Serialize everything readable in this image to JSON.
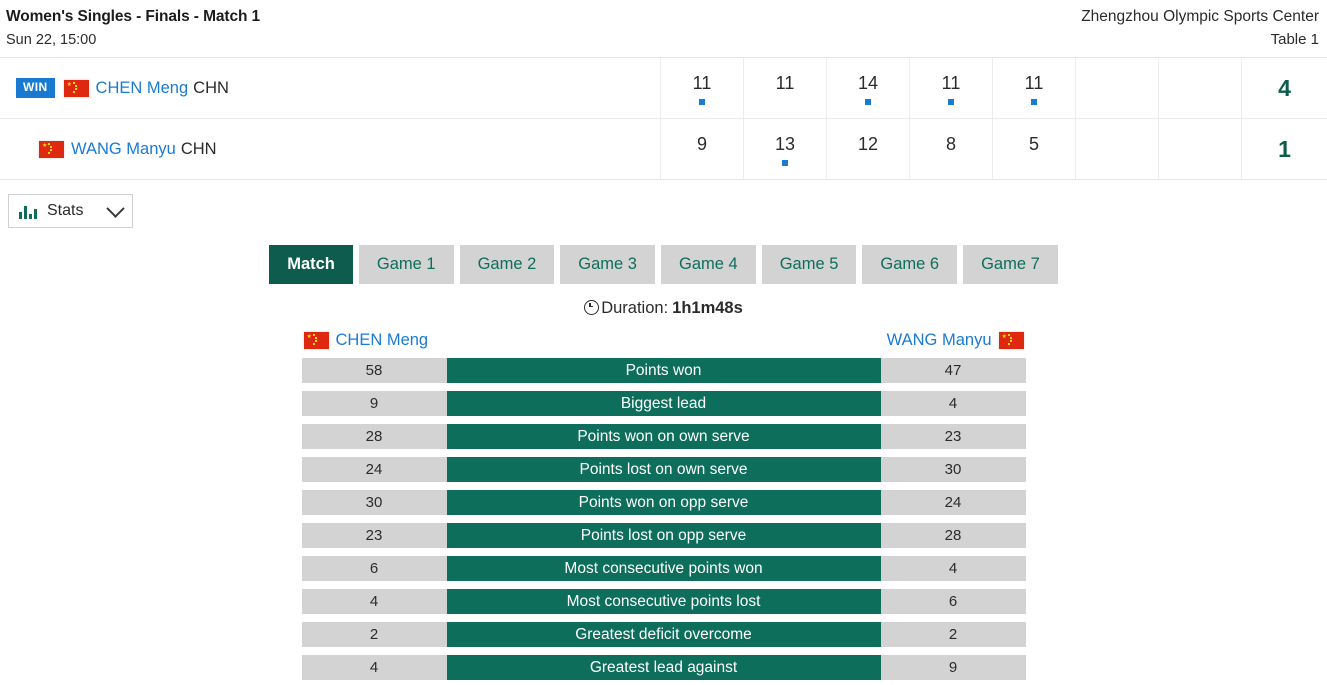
{
  "header": {
    "title": "Women's Singles - Finals - Match 1",
    "datetime": "Sun 22, 15:00",
    "venue": "Zhengzhou Olympic Sports Center",
    "table": "Table 1"
  },
  "scoreboard": {
    "players": [
      {
        "win_badge": "WIN",
        "is_winner": true,
        "flag_icon": "china-flag-icon",
        "name": "CHEN Meng",
        "country": "CHN",
        "games": [
          "11",
          "11",
          "14",
          "11",
          "11",
          "",
          "",
          ""
        ],
        "game_won": [
          true,
          false,
          true,
          true,
          true,
          false,
          false,
          false
        ],
        "total": "4"
      },
      {
        "win_badge": "",
        "is_winner": false,
        "flag_icon": "china-flag-icon",
        "name": "WANG Manyu",
        "country": "CHN",
        "games": [
          "9",
          "13",
          "12",
          "8",
          "5",
          "",
          "",
          ""
        ],
        "game_won": [
          false,
          true,
          false,
          false,
          false,
          false,
          false,
          false
        ],
        "total": "1"
      }
    ]
  },
  "stats_selector": {
    "icon": "bar-chart-icon",
    "label": "Stats",
    "chevron_icon": "chevron-down-icon"
  },
  "tabs": [
    {
      "label": "Match",
      "active": true
    },
    {
      "label": "Game 1",
      "active": false
    },
    {
      "label": "Game 2",
      "active": false
    },
    {
      "label": "Game 3",
      "active": false
    },
    {
      "label": "Game 4",
      "active": false
    },
    {
      "label": "Game 5",
      "active": false
    },
    {
      "label": "Game 6",
      "active": false
    },
    {
      "label": "Game 7",
      "active": false
    }
  ],
  "duration": {
    "icon": "clock-icon",
    "label": "Duration:",
    "value": "1h1m48s"
  },
  "stats": {
    "player_left": {
      "name": "CHEN Meng",
      "flag_icon": "china-flag-icon"
    },
    "player_right": {
      "name": "WANG Manyu",
      "flag_icon": "china-flag-icon"
    },
    "rows": [
      {
        "label": "Points won",
        "left": "58",
        "right": "47"
      },
      {
        "label": "Biggest lead",
        "left": "9",
        "right": "4"
      },
      {
        "label": "Points won on own serve",
        "left": "28",
        "right": "23"
      },
      {
        "label": "Points lost on own serve",
        "left": "24",
        "right": "30"
      },
      {
        "label": "Points won on opp serve",
        "left": "30",
        "right": "24"
      },
      {
        "label": "Points lost on opp serve",
        "left": "23",
        "right": "28"
      },
      {
        "label": "Most consecutive points won",
        "left": "6",
        "right": "4"
      },
      {
        "label": "Most consecutive points lost",
        "left": "4",
        "right": "6"
      },
      {
        "label": "Greatest deficit overcome",
        "left": "2",
        "right": "2"
      },
      {
        "label": "Greatest lead against",
        "left": "4",
        "right": "9"
      }
    ]
  },
  "colors": {
    "accent_green": "#0d6e5b",
    "active_tab_green": "#0d5c4e",
    "link_blue": "#1a7ad4",
    "win_badge_blue": "#1779cf",
    "value_gray": "#d3d3d3"
  }
}
